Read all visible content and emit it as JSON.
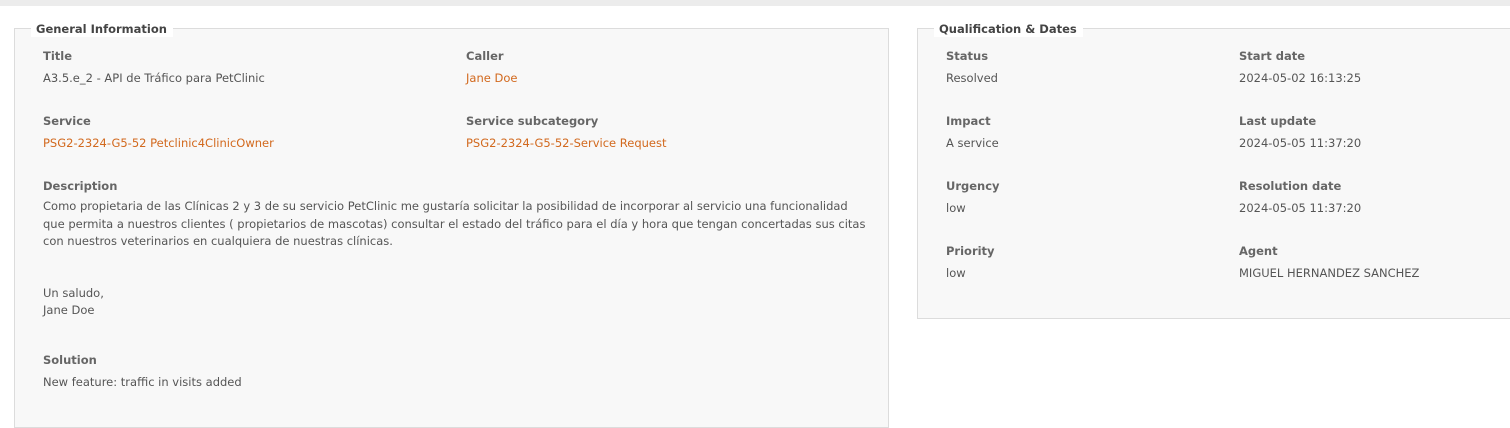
{
  "colors": {
    "link": "#d2691e",
    "panel_bg": "#f8f8f8",
    "border": "#dcdcdc"
  },
  "general": {
    "legend": "General Information",
    "title_label": "Title",
    "title_value": "A3.5.e_2 - API de Tráfico para PetClinic",
    "caller_label": "Caller",
    "caller_value": "Jane Doe",
    "service_label": "Service",
    "service_value": "PSG2-2324-G5-52 Petclinic4ClinicOwner",
    "subcategory_label": "Service subcategory",
    "subcategory_value": "PSG2-2324-G5-52-Service Request",
    "description_label": "Description",
    "description_lines": [
      "Como propietaria de las Clínicas 2 y 3 de su servicio PetClinic me gustaría solicitar la  posibilidad de incorporar al servicio una funcionalidad que permita a nuestros clientes ( propietarios de mascotas) consultar el estado del tráfico para el día y hora que tengan concertadas sus citas con nuestros veterinarios en cualquiera de nuestras clínicas.",
      "Un saludo,",
      "Jane Doe"
    ],
    "solution_label": "Solution",
    "solution_value": "New feature: traffic in visits added"
  },
  "qualification": {
    "legend": "Qualification & Dates",
    "status_label": "Status",
    "status_value": "Resolved",
    "start_label": "Start date",
    "start_value": "2024-05-02 16:13:25",
    "impact_label": "Impact",
    "impact_value": "A service",
    "update_label": "Last update",
    "update_value": "2024-05-05 11:37:20",
    "urgency_label": "Urgency",
    "urgency_value": "low",
    "resolution_label": "Resolution date",
    "resolution_value": "2024-05-05 11:37:20",
    "priority_label": "Priority",
    "priority_value": "low",
    "agent_label": "Agent",
    "agent_value": "MIGUEL HERNANDEZ SANCHEZ"
  }
}
